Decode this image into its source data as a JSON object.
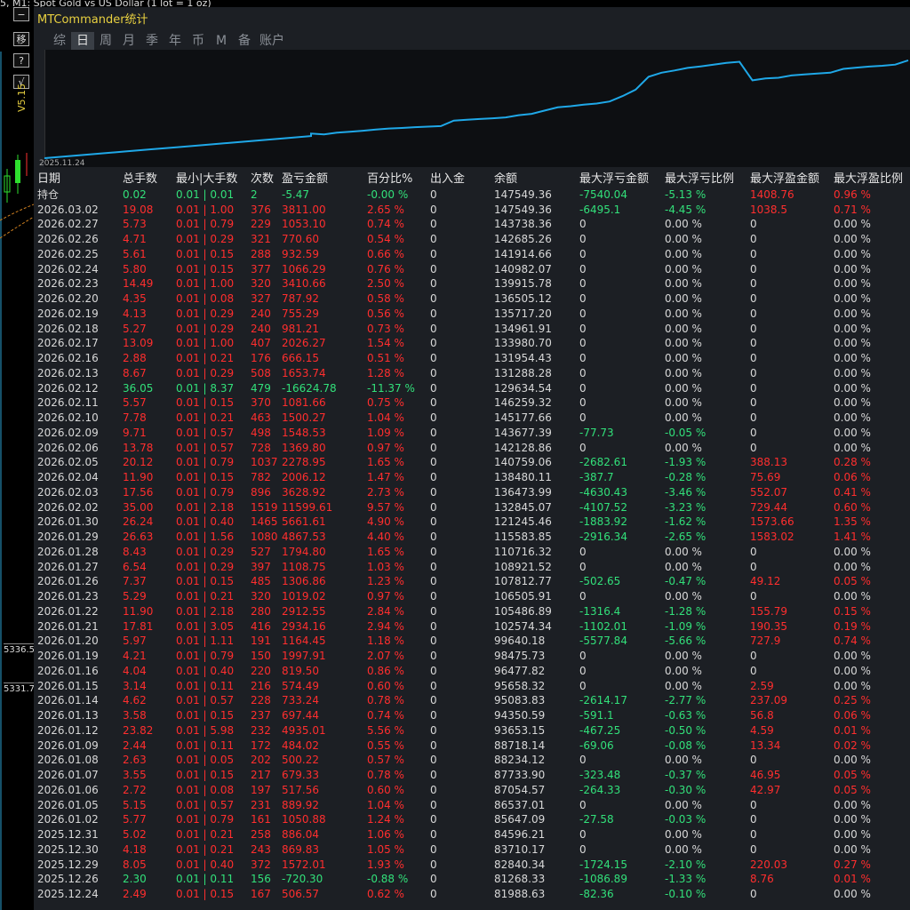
{
  "host": {
    "title": "5, M1: Spot Gold vs US Dollar (1 lot = 1 oz)",
    "buttons": [
      "−",
      "移",
      "?",
      "√"
    ],
    "version": "V5.15",
    "price_labels": [
      "5336.5",
      "5331.7"
    ]
  },
  "panel": {
    "title": "MTCommander统计",
    "tabs": [
      "综",
      "日",
      "周",
      "月",
      "季",
      "年",
      "币",
      "M",
      "备",
      "账户"
    ],
    "active_tab": 1,
    "curve_start_date": "2025.11.24"
  },
  "table": {
    "headers": [
      "日期",
      "总手数",
      "最小|大手数",
      "次数",
      "盈亏金额",
      "百分比%",
      "出入金",
      "余额",
      "最大浮亏金额",
      "最大浮亏比例",
      "最大浮盈金额",
      "最大浮盈比例"
    ],
    "rows": [
      [
        "持仓",
        "0.02",
        "0.01 | 0.01",
        "2",
        "-5.47",
        "-0.00 %",
        "0",
        "147549.36",
        "-7540.04",
        "-5.13 %",
        "1408.76",
        "0.96 %"
      ],
      [
        "2026.03.02",
        "19.08",
        "0.01 | 1.00",
        "376",
        "3811.00",
        "2.65 %",
        "0",
        "147549.36",
        "-6495.1",
        "-4.45 %",
        "1038.5",
        "0.71 %"
      ],
      [
        "2026.02.27",
        "5.73",
        "0.01 | 0.79",
        "229",
        "1053.10",
        "0.74 %",
        "0",
        "143738.36",
        "0",
        "0.00 %",
        "0",
        "0.00 %"
      ],
      [
        "2026.02.26",
        "4.71",
        "0.01 | 0.29",
        "321",
        "770.60",
        "0.54 %",
        "0",
        "142685.26",
        "0",
        "0.00 %",
        "0",
        "0.00 %"
      ],
      [
        "2026.02.25",
        "5.61",
        "0.01 | 0.15",
        "288",
        "932.59",
        "0.66 %",
        "0",
        "141914.66",
        "0",
        "0.00 %",
        "0",
        "0.00 %"
      ],
      [
        "2026.02.24",
        "5.80",
        "0.01 | 0.15",
        "377",
        "1066.29",
        "0.76 %",
        "0",
        "140982.07",
        "0",
        "0.00 %",
        "0",
        "0.00 %"
      ],
      [
        "2026.02.23",
        "14.49",
        "0.01 | 1.00",
        "320",
        "3410.66",
        "2.50 %",
        "0",
        "139915.78",
        "0",
        "0.00 %",
        "0",
        "0.00 %"
      ],
      [
        "2026.02.20",
        "4.35",
        "0.01 | 0.08",
        "327",
        "787.92",
        "0.58 %",
        "0",
        "136505.12",
        "0",
        "0.00 %",
        "0",
        "0.00 %"
      ],
      [
        "2026.02.19",
        "4.13",
        "0.01 | 0.29",
        "240",
        "755.29",
        "0.56 %",
        "0",
        "135717.20",
        "0",
        "0.00 %",
        "0",
        "0.00 %"
      ],
      [
        "2026.02.18",
        "5.27",
        "0.01 | 0.29",
        "240",
        "981.21",
        "0.73 %",
        "0",
        "134961.91",
        "0",
        "0.00 %",
        "0",
        "0.00 %"
      ],
      [
        "2026.02.17",
        "13.09",
        "0.01 | 1.00",
        "407",
        "2026.27",
        "1.54 %",
        "0",
        "133980.70",
        "0",
        "0.00 %",
        "0",
        "0.00 %"
      ],
      [
        "2026.02.16",
        "2.88",
        "0.01 | 0.21",
        "176",
        "666.15",
        "0.51 %",
        "0",
        "131954.43",
        "0",
        "0.00 %",
        "0",
        "0.00 %"
      ],
      [
        "2026.02.13",
        "8.67",
        "0.01 | 0.29",
        "508",
        "1653.74",
        "1.28 %",
        "0",
        "131288.28",
        "0",
        "0.00 %",
        "0",
        "0.00 %"
      ],
      [
        "2026.02.12",
        "36.05",
        "0.01 | 8.37",
        "479",
        "-16624.78",
        "-11.37 %",
        "0",
        "129634.54",
        "0",
        "0.00 %",
        "0",
        "0.00 %"
      ],
      [
        "2026.02.11",
        "5.57",
        "0.01 | 0.15",
        "370",
        "1081.66",
        "0.75 %",
        "0",
        "146259.32",
        "0",
        "0.00 %",
        "0",
        "0.00 %"
      ],
      [
        "2026.02.10",
        "7.78",
        "0.01 | 0.21",
        "463",
        "1500.27",
        "1.04 %",
        "0",
        "145177.66",
        "0",
        "0.00 %",
        "0",
        "0.00 %"
      ],
      [
        "2026.02.09",
        "9.71",
        "0.01 | 0.57",
        "498",
        "1548.53",
        "1.09 %",
        "0",
        "143677.39",
        "-77.73",
        "-0.05 %",
        "0",
        "0.00 %"
      ],
      [
        "2026.02.06",
        "13.78",
        "0.01 | 0.57",
        "728",
        "1369.80",
        "0.97 %",
        "0",
        "142128.86",
        "0",
        "0.00 %",
        "0",
        "0.00 %"
      ],
      [
        "2026.02.05",
        "20.12",
        "0.01 | 0.79",
        "1037",
        "2278.95",
        "1.65 %",
        "0",
        "140759.06",
        "-2682.61",
        "-1.93 %",
        "388.13",
        "0.28 %"
      ],
      [
        "2026.02.04",
        "11.90",
        "0.01 | 0.15",
        "782",
        "2006.12",
        "1.47 %",
        "0",
        "138480.11",
        "-387.7",
        "-0.28 %",
        "75.69",
        "0.06 %"
      ],
      [
        "2026.02.03",
        "17.56",
        "0.01 | 0.79",
        "896",
        "3628.92",
        "2.73 %",
        "0",
        "136473.99",
        "-4630.43",
        "-3.46 %",
        "552.07",
        "0.41 %"
      ],
      [
        "2026.02.02",
        "35.00",
        "0.01 | 2.18",
        "1519",
        "11599.61",
        "9.57 %",
        "0",
        "132845.07",
        "-4107.52",
        "-3.23 %",
        "729.44",
        "0.60 %"
      ],
      [
        "2026.01.30",
        "26.24",
        "0.01 | 0.40",
        "1465",
        "5661.61",
        "4.90 %",
        "0",
        "121245.46",
        "-1883.92",
        "-1.62 %",
        "1573.66",
        "1.35 %"
      ],
      [
        "2026.01.29",
        "26.63",
        "0.01 | 1.56",
        "1080",
        "4867.53",
        "4.40 %",
        "0",
        "115583.85",
        "-2916.34",
        "-2.65 %",
        "1583.02",
        "1.41 %"
      ],
      [
        "2026.01.28",
        "8.43",
        "0.01 | 0.29",
        "527",
        "1794.80",
        "1.65 %",
        "0",
        "110716.32",
        "0",
        "0.00 %",
        "0",
        "0.00 %"
      ],
      [
        "2026.01.27",
        "6.54",
        "0.01 | 0.29",
        "397",
        "1108.75",
        "1.03 %",
        "0",
        "108921.52",
        "0",
        "0.00 %",
        "0",
        "0.00 %"
      ],
      [
        "2026.01.26",
        "7.37",
        "0.01 | 0.15",
        "485",
        "1306.86",
        "1.23 %",
        "0",
        "107812.77",
        "-502.65",
        "-0.47 %",
        "49.12",
        "0.05 %"
      ],
      [
        "2026.01.23",
        "5.29",
        "0.01 | 0.21",
        "320",
        "1019.02",
        "0.97 %",
        "0",
        "106505.91",
        "0",
        "0.00 %",
        "0",
        "0.00 %"
      ],
      [
        "2026.01.22",
        "11.90",
        "0.01 | 2.18",
        "280",
        "2912.55",
        "2.84 %",
        "0",
        "105486.89",
        "-1316.4",
        "-1.28 %",
        "155.79",
        "0.15 %"
      ],
      [
        "2026.01.21",
        "17.81",
        "0.01 | 3.05",
        "416",
        "2934.16",
        "2.94 %",
        "0",
        "102574.34",
        "-1102.01",
        "-1.09 %",
        "190.35",
        "0.19 %"
      ],
      [
        "2026.01.20",
        "5.97",
        "0.01 | 1.11",
        "191",
        "1164.45",
        "1.18 %",
        "0",
        "99640.18",
        "-5577.84",
        "-5.66 %",
        "727.9",
        "0.74 %"
      ],
      [
        "2026.01.19",
        "4.21",
        "0.01 | 0.79",
        "150",
        "1997.91",
        "2.07 %",
        "0",
        "98475.73",
        "0",
        "0.00 %",
        "0",
        "0.00 %"
      ],
      [
        "2026.01.16",
        "4.04",
        "0.01 | 0.40",
        "220",
        "819.50",
        "0.86 %",
        "0",
        "96477.82",
        "0",
        "0.00 %",
        "0",
        "0.00 %"
      ],
      [
        "2026.01.15",
        "3.14",
        "0.01 | 0.11",
        "216",
        "574.49",
        "0.60 %",
        "0",
        "95658.32",
        "0",
        "0.00 %",
        "2.59",
        "0.00 %"
      ],
      [
        "2026.01.14",
        "4.62",
        "0.01 | 0.57",
        "228",
        "733.24",
        "0.78 %",
        "0",
        "95083.83",
        "-2614.17",
        "-2.77 %",
        "237.09",
        "0.25 %"
      ],
      [
        "2026.01.13",
        "3.58",
        "0.01 | 0.15",
        "237",
        "697.44",
        "0.74 %",
        "0",
        "94350.59",
        "-591.1",
        "-0.63 %",
        "56.8",
        "0.06 %"
      ],
      [
        "2026.01.12",
        "23.82",
        "0.01 | 5.98",
        "232",
        "4935.01",
        "5.56 %",
        "0",
        "93653.15",
        "-467.25",
        "-0.50 %",
        "4.59",
        "0.01 %"
      ],
      [
        "2026.01.09",
        "2.44",
        "0.01 | 0.11",
        "172",
        "484.02",
        "0.55 %",
        "0",
        "88718.14",
        "-69.06",
        "-0.08 %",
        "13.34",
        "0.02 %"
      ],
      [
        "2026.01.08",
        "2.63",
        "0.01 | 0.05",
        "202",
        "500.22",
        "0.57 %",
        "0",
        "88234.12",
        "0",
        "0.00 %",
        "0",
        "0.00 %"
      ],
      [
        "2026.01.07",
        "3.55",
        "0.01 | 0.15",
        "217",
        "679.33",
        "0.78 %",
        "0",
        "87733.90",
        "-323.48",
        "-0.37 %",
        "46.95",
        "0.05 %"
      ],
      [
        "2026.01.06",
        "2.72",
        "0.01 | 0.08",
        "197",
        "517.56",
        "0.60 %",
        "0",
        "87054.57",
        "-264.33",
        "-0.30 %",
        "42.97",
        "0.05 %"
      ],
      [
        "2026.01.05",
        "5.15",
        "0.01 | 0.57",
        "231",
        "889.92",
        "1.04 %",
        "0",
        "86537.01",
        "0",
        "0.00 %",
        "0",
        "0.00 %"
      ],
      [
        "2026.01.02",
        "5.77",
        "0.01 | 0.79",
        "161",
        "1050.88",
        "1.24 %",
        "0",
        "85647.09",
        "-27.58",
        "-0.03 %",
        "0",
        "0.00 %"
      ],
      [
        "2025.12.31",
        "5.02",
        "0.01 | 0.21",
        "258",
        "886.04",
        "1.06 %",
        "0",
        "84596.21",
        "0",
        "0.00 %",
        "0",
        "0.00 %"
      ],
      [
        "2025.12.30",
        "4.18",
        "0.01 | 0.21",
        "243",
        "869.83",
        "1.05 %",
        "0",
        "83710.17",
        "0",
        "0.00 %",
        "0",
        "0.00 %"
      ],
      [
        "2025.12.29",
        "8.05",
        "0.01 | 0.40",
        "372",
        "1572.01",
        "1.93 %",
        "0",
        "82840.34",
        "-1724.15",
        "-2.10 %",
        "220.03",
        "0.27 %"
      ],
      [
        "2025.12.26",
        "2.30",
        "0.01 | 0.11",
        "156",
        "-720.30",
        "-0.88 %",
        "0",
        "81268.33",
        "-1086.89",
        "-1.33 %",
        "8.76",
        "0.01 %"
      ],
      [
        "2025.12.24",
        "2.49",
        "0.01 | 0.15",
        "167",
        "506.57",
        "0.62 %",
        "0",
        "81988.63",
        "-82.36",
        "-0.10 %",
        "0",
        "0.00 %"
      ]
    ]
  },
  "colors": {
    "profit": "#ff2e2e",
    "loss": "#32e07a",
    "neutral": "#d8d8d8",
    "curve": "#1fa8e8",
    "title": "#e8d040"
  }
}
